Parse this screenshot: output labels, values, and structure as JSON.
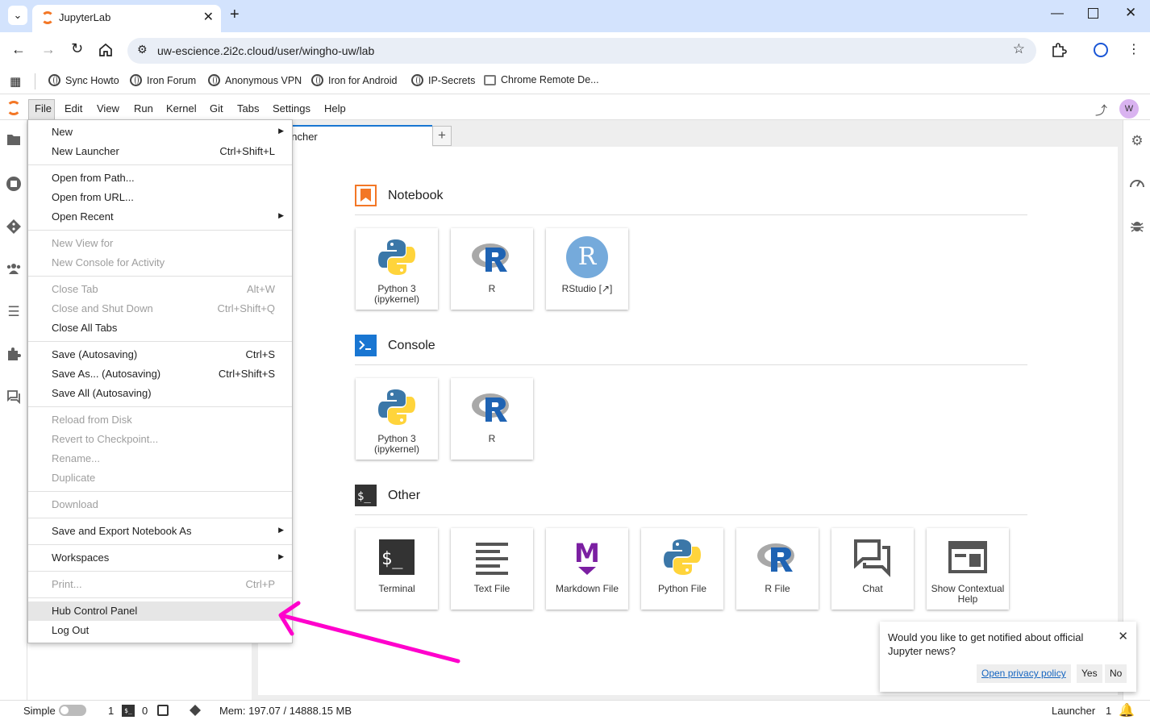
{
  "browser": {
    "tab_title": "JupyterLab",
    "url": "uw-escience.2i2c.cloud/user/wingho-uw/lab",
    "bookmarks": [
      "Sync Howto",
      "Iron Forum",
      "Anonymous VPN",
      "Iron for Android",
      "IP-Secrets",
      "Chrome Remote De..."
    ]
  },
  "jupyter": {
    "menubar": [
      "File",
      "Edit",
      "View",
      "Run",
      "Kernel",
      "Git",
      "Tabs",
      "Settings",
      "Help"
    ],
    "user_initial": "W",
    "tab_label": "uncher",
    "file_menu": [
      {
        "label": "New",
        "shortcut": "",
        "submenu": true,
        "disabled": false
      },
      {
        "label": "New Launcher",
        "shortcut": "Ctrl+Shift+L",
        "submenu": false,
        "disabled": false
      },
      {
        "label": "Open from Path...",
        "shortcut": "",
        "submenu": false,
        "disabled": false
      },
      {
        "label": "Open from URL...",
        "shortcut": "",
        "submenu": false,
        "disabled": false
      },
      {
        "label": "Open Recent",
        "shortcut": "",
        "submenu": true,
        "disabled": false
      },
      {
        "label": "New View for",
        "shortcut": "",
        "submenu": false,
        "disabled": true
      },
      {
        "label": "New Console for Activity",
        "shortcut": "",
        "submenu": false,
        "disabled": true
      },
      {
        "label": "Close Tab",
        "shortcut": "Alt+W",
        "submenu": false,
        "disabled": true
      },
      {
        "label": "Close and Shut Down",
        "shortcut": "Ctrl+Shift+Q",
        "submenu": false,
        "disabled": true
      },
      {
        "label": "Close All Tabs",
        "shortcut": "",
        "submenu": false,
        "disabled": false
      },
      {
        "label": "Save (Autosaving)",
        "shortcut": "Ctrl+S",
        "submenu": false,
        "disabled": false
      },
      {
        "label": "Save As... (Autosaving)",
        "shortcut": "Ctrl+Shift+S",
        "submenu": false,
        "disabled": false
      },
      {
        "label": "Save All (Autosaving)",
        "shortcut": "",
        "submenu": false,
        "disabled": false
      },
      {
        "label": "Reload from Disk",
        "shortcut": "",
        "submenu": false,
        "disabled": true
      },
      {
        "label": "Revert to Checkpoint...",
        "shortcut": "",
        "submenu": false,
        "disabled": true
      },
      {
        "label": "Rename...",
        "shortcut": "",
        "submenu": false,
        "disabled": true
      },
      {
        "label": "Duplicate",
        "shortcut": "",
        "submenu": false,
        "disabled": true
      },
      {
        "label": "Download",
        "shortcut": "",
        "submenu": false,
        "disabled": true
      },
      {
        "label": "Save and Export Notebook As",
        "shortcut": "",
        "submenu": true,
        "disabled": false
      },
      {
        "label": "Workspaces",
        "shortcut": "",
        "submenu": true,
        "disabled": false
      },
      {
        "label": "Print...",
        "shortcut": "Ctrl+P",
        "submenu": false,
        "disabled": true
      },
      {
        "label": "Hub Control Panel",
        "shortcut": "",
        "submenu": false,
        "disabled": false,
        "highlighted": true
      },
      {
        "label": "Log Out",
        "shortcut": "",
        "submenu": false,
        "disabled": false
      }
    ],
    "launcher": {
      "sections": [
        {
          "title": "Notebook",
          "cards": [
            "Python 3\n(ipykernel)",
            "R",
            "RStudio [↗]"
          ]
        },
        {
          "title": "Console",
          "cards": [
            "Python 3\n(ipykernel)",
            "R"
          ]
        },
        {
          "title": "Other",
          "cards": [
            "Terminal",
            "Text File",
            "Markdown File",
            "Python File",
            "R File",
            "Chat",
            "Show Contextual\nHelp"
          ]
        }
      ]
    },
    "notification": {
      "message": "Would you like to get notified about official Jupyter news?",
      "privacy_link": "Open privacy policy",
      "yes": "Yes",
      "no": "No"
    },
    "status": {
      "mode": "Simple",
      "terminals": "1",
      "kernels": "0",
      "memory": "Mem: 197.07 / 14888.15 MB",
      "right_label": "Launcher",
      "right_count": "1"
    }
  },
  "annotation": {
    "color": "#ff00cc"
  }
}
